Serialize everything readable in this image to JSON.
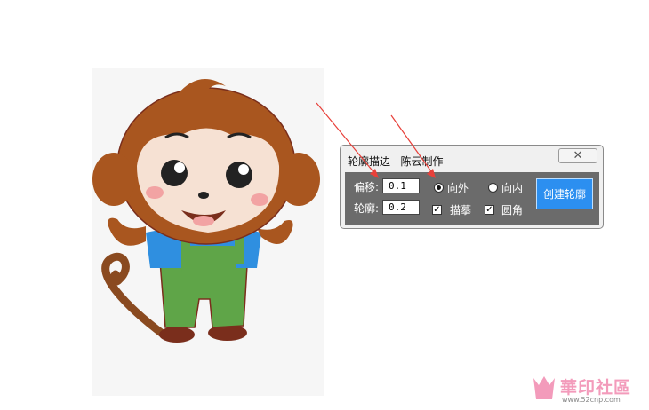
{
  "dialog": {
    "title": "轮廓描边   陈云制作",
    "close_icon": "close-icon",
    "offset_label": "偏移:",
    "offset_value": "0.1",
    "outline_label": "轮廓:",
    "outline_value": "0.2",
    "direction": {
      "outward_label": "向外",
      "inward_label": "向内",
      "selected": "outward"
    },
    "trace_label": "描摹",
    "trace_checked": true,
    "round_label": "圆角",
    "round_checked": true,
    "create_label": "创建轮廓"
  },
  "colors": {
    "accent": "#2c8ff0",
    "panel": "#6b6b6b",
    "arrow": "#e8403a"
  },
  "watermark": {
    "text": "華印社區",
    "url": "www.52cnp.com"
  }
}
